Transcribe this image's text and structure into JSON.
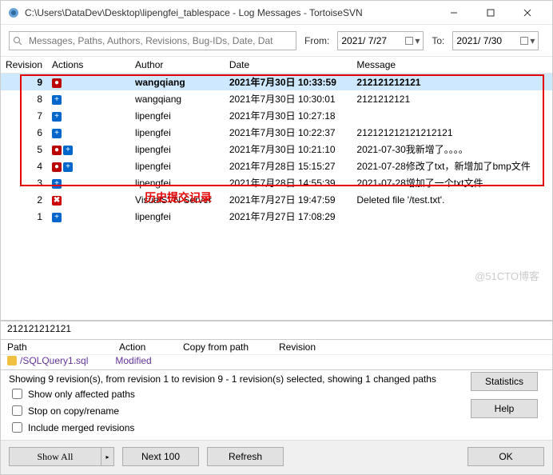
{
  "window": {
    "title": "C:\\Users\\DataDev\\Desktop\\lipengfei_tablespace - Log Messages - TortoiseSVN"
  },
  "toolbar": {
    "search_placeholder": "Messages, Paths, Authors, Revisions, Bug-IDs, Date, Dat",
    "from_label": "From:",
    "to_label": "To:",
    "from_value": "2021/ 7/27",
    "to_value": "2021/ 7/30"
  },
  "columns": {
    "revision": "Revision",
    "actions": "Actions",
    "author": "Author",
    "date": "Date",
    "message": "Message"
  },
  "rows": [
    {
      "rev": "9",
      "actions": [
        "mod"
      ],
      "author": "wangqiang",
      "date": "2021年7月30日 10:33:59",
      "message": "212121212121",
      "selected": true
    },
    {
      "rev": "8",
      "actions": [
        "add"
      ],
      "author": "wangqiang",
      "date": "2021年7月30日 10:30:01",
      "message": "2121212121"
    },
    {
      "rev": "7",
      "actions": [
        "add"
      ],
      "author": "lipengfei",
      "date": "2021年7月30日 10:27:18",
      "message": ""
    },
    {
      "rev": "6",
      "actions": [
        "add"
      ],
      "author": "lipengfei",
      "date": "2021年7月30日 10:22:37",
      "message": "212121212121212121"
    },
    {
      "rev": "5",
      "actions": [
        "mod",
        "add"
      ],
      "author": "lipengfei",
      "date": "2021年7月30日 10:21:10",
      "message": "2021-07-30我新增了。。。。"
    },
    {
      "rev": "4",
      "actions": [
        "mod",
        "add"
      ],
      "author": "lipengfei",
      "date": "2021年7月28日 15:15:27",
      "message": "2021-07-28修改了txt，新增加了bmp文件"
    },
    {
      "rev": "3",
      "actions": [
        "add"
      ],
      "author": "lipengfei",
      "date": "2021年7月28日 14:55:39",
      "message": "2021-07-28增加了一个txt文件"
    },
    {
      "rev": "2",
      "actions": [
        "del"
      ],
      "author": "VisualSVN Server",
      "date": "2021年7月27日 19:47:59",
      "message": "Deleted file '/test.txt'."
    },
    {
      "rev": "1",
      "actions": [
        "add"
      ],
      "author": "lipengfei",
      "date": "2021年7月27日 17:08:29",
      "message": ""
    }
  ],
  "annotation": "历史提交记录",
  "msg_preview": "212121212121",
  "paths": {
    "headers": {
      "path": "Path",
      "action": "Action",
      "copy_from": "Copy from path",
      "revision": "Revision"
    },
    "row": {
      "path": "/SQLQuery1.sql",
      "action": "Modified"
    }
  },
  "status_line": "Showing 9 revision(s), from revision 1 to revision 9 - 1 revision(s) selected, showing 1 changed paths",
  "checks": {
    "affected": "Show only affected paths",
    "stop": "Stop on copy/rename",
    "merged": "Include merged revisions"
  },
  "buttons": {
    "statistics": "Statistics",
    "help": "Help",
    "show_all": "Show All",
    "next100": "Next 100",
    "refresh": "Refresh",
    "ok": "OK"
  },
  "watermark": "@51CTO博客"
}
